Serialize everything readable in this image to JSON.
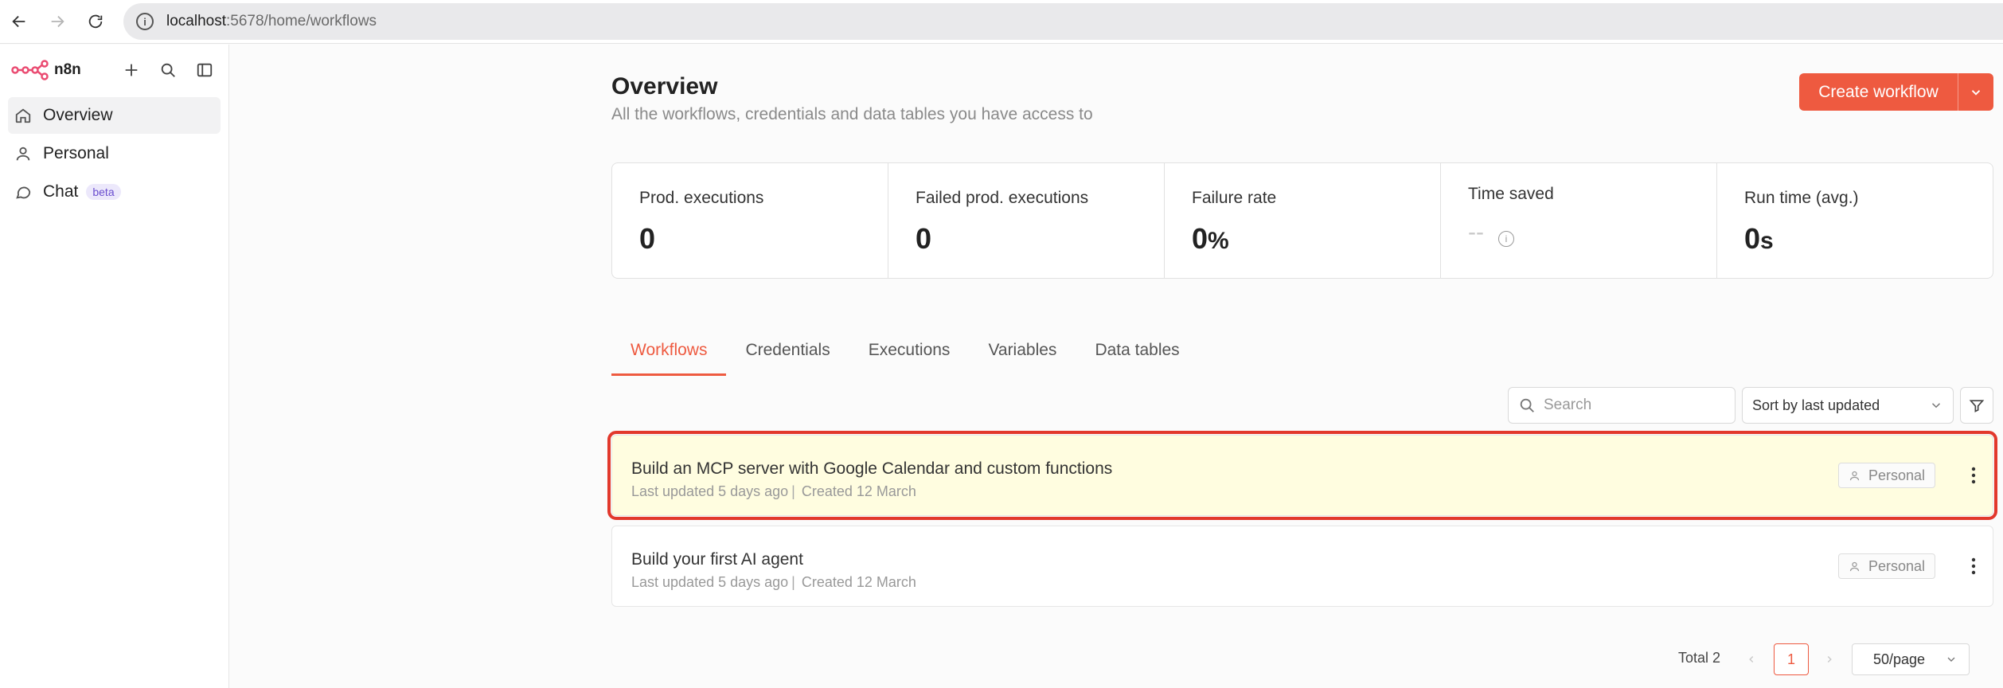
{
  "browser": {
    "url_host": "localhost",
    "url_path": ":5678/home/workflows"
  },
  "sidebar": {
    "brand": "n8n",
    "items": [
      {
        "label": "Overview",
        "icon": "home-icon"
      },
      {
        "label": "Personal",
        "icon": "user-icon"
      },
      {
        "label": "Chat",
        "icon": "chat-icon",
        "badge": "beta"
      }
    ]
  },
  "header": {
    "title": "Overview",
    "subtitle": "All the workflows, credentials and data tables you have access to",
    "create_label": "Create workflow"
  },
  "stats": [
    {
      "label": "Prod. executions",
      "value": "0",
      "unit": ""
    },
    {
      "label": "Failed prod. executions",
      "value": "0",
      "unit": ""
    },
    {
      "label": "Failure rate",
      "value": "0",
      "unit": "%"
    },
    {
      "label": "Time saved",
      "value": "--",
      "unit": ""
    },
    {
      "label": "Run time (avg.)",
      "value": "0",
      "unit": "s"
    }
  ],
  "tabs": [
    "Workflows",
    "Credentials",
    "Executions",
    "Variables",
    "Data tables"
  ],
  "toolbar": {
    "search_placeholder": "Search",
    "sort_label": "Sort by last updated"
  },
  "workflows": [
    {
      "name": "Build an MCP server with Google Calendar and custom functions",
      "updated": "Last updated 5 days ago",
      "created": "Created 12 March",
      "owner": "Personal"
    },
    {
      "name": "Build your first AI agent",
      "updated": "Last updated 5 days ago",
      "created": "Created 12 March",
      "owner": "Personal"
    }
  ],
  "pagination": {
    "total": "Total 2",
    "current_page": "1",
    "per_page": "50/page"
  },
  "colors": {
    "accent": "#ee5a40",
    "highlight_bg": "#fffde0",
    "highlight_border": "#e2382c"
  }
}
